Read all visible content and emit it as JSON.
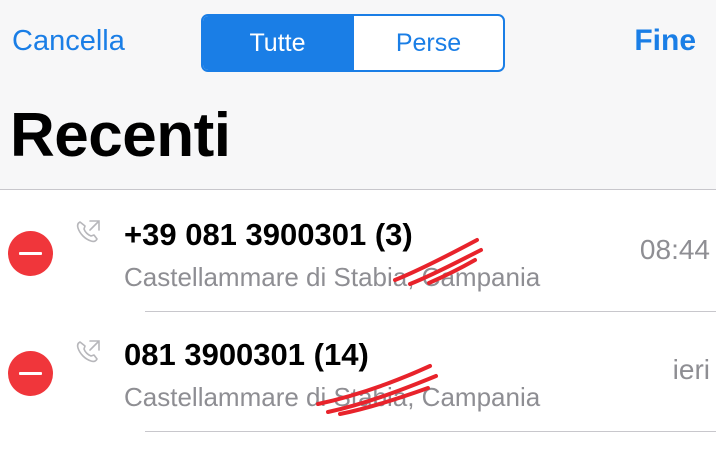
{
  "nav": {
    "cancel_label": "Cancella",
    "done_label": "Fine",
    "segments": [
      {
        "label": "Tutte",
        "selected": true
      },
      {
        "label": "Perse",
        "selected": false
      }
    ]
  },
  "title": "Recenti",
  "calls": [
    {
      "number": "+39 081 3900301 (3)",
      "location": "Castellammare di Stabia, Campania",
      "time": "08:44",
      "icon": "outgoing-call-icon"
    },
    {
      "number": "081 3900301 (14)",
      "location": "Castellammare di Stabia, Campania",
      "time": "ieri",
      "icon": "outgoing-call-icon"
    }
  ],
  "colors": {
    "accent": "#1a7ee6",
    "delete": "#f0363b",
    "secondary_text": "#8e8e93",
    "header_bg": "#f7f7f8",
    "redaction": "#e8232b"
  }
}
